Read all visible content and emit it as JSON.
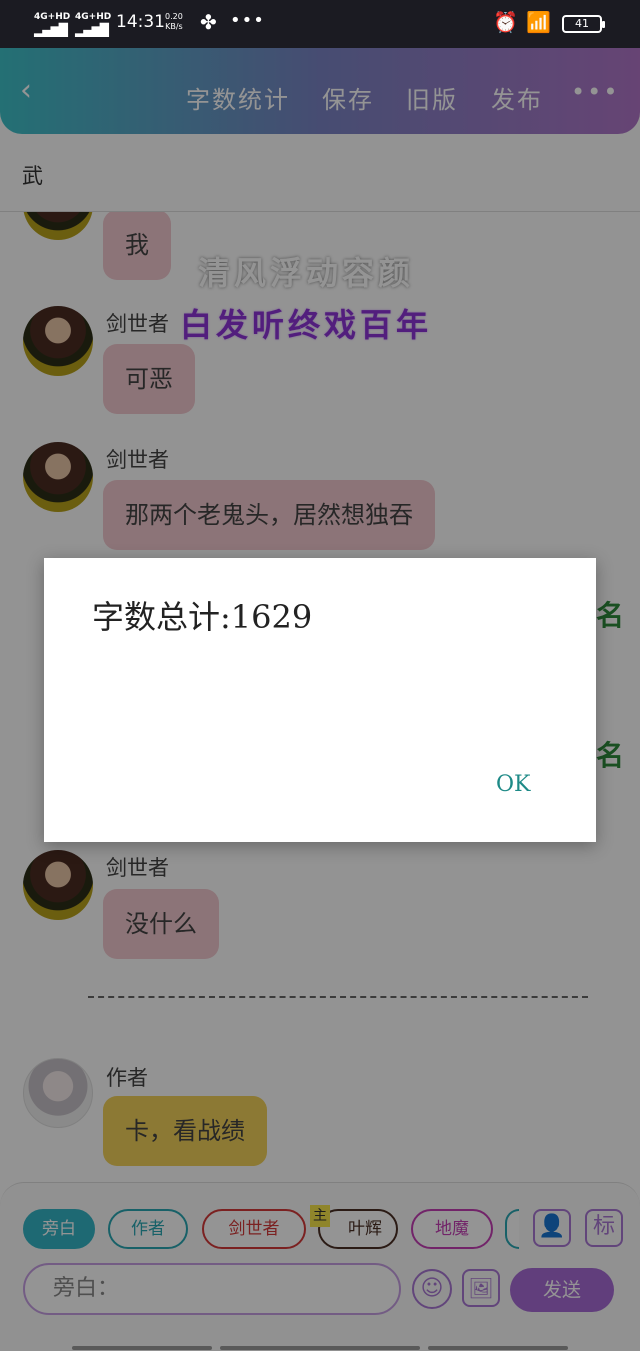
{
  "status_bar": {
    "signal1": "4G+HD",
    "signal2": "4G+HD",
    "time": "14:31",
    "speed_value": "0.20",
    "speed_unit": "KB/s",
    "more": "•••",
    "battery": "41"
  },
  "toolbar": {
    "back": "‹",
    "word_count": "字数统计",
    "save": "保存",
    "old_version": "旧版",
    "publish": "发布",
    "more": "•••"
  },
  "chapter_title": "武",
  "floating_text": {
    "line1": "清风浮动容颜",
    "line2": "白发听终戏百年"
  },
  "messages": [
    {
      "speaker": "",
      "text": "我"
    },
    {
      "speaker": "剑世者",
      "text": "可恶"
    },
    {
      "speaker": "剑世者",
      "text": "那两个老鬼头，居然想独吞"
    },
    {
      "speaker": "剑世者",
      "text": "没什么"
    },
    {
      "speaker": "作者",
      "text": "卡，看战绩"
    }
  ],
  "roles": {
    "narration": "旁白",
    "author": "作者",
    "jian_shi_zhe": "剑世者",
    "main_badge": "主",
    "ye_hui": "叶辉",
    "di_mo": "地魔",
    "avatar_icon": "user-icon",
    "tag_label": "标"
  },
  "input": {
    "value": "旁白：",
    "send": "发送"
  },
  "dialog": {
    "message": "字数总计:1629",
    "ok": "OK"
  },
  "colors": {
    "toolbar_start": "#3ec1c9",
    "toolbar_end": "#b176c9",
    "bubble_pink": "#f2c9cf",
    "bubble_yellow": "#f2d15a",
    "accent_purple": "#a76bd6",
    "ok_teal": "#1e8a87"
  }
}
